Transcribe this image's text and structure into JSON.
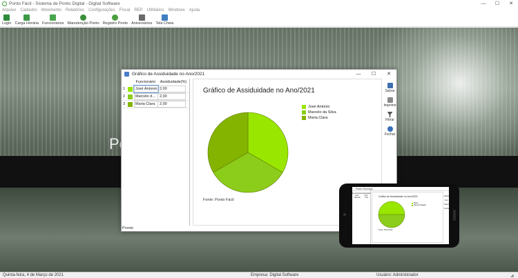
{
  "app": {
    "title": "Ponto Fácil - Sistema de Ponto Digital - Digital Software"
  },
  "window_controls": [
    "—",
    "☐",
    "✕"
  ],
  "menu": [
    "Arquivo",
    "Cadastro",
    "Movimento",
    "Relatórios",
    "Configurações",
    "Fiscal",
    "REP",
    "Utilitários",
    "Windows",
    "Ajuda"
  ],
  "toolbar": [
    {
      "label": "Login",
      "icon": "login-icon",
      "color": "#2e8b3a"
    },
    {
      "label": "Carga Horária",
      "icon": "schedule-icon",
      "color": "#3c9a46"
    },
    {
      "label": "Funcionários",
      "icon": "employees-icon",
      "color": "#4aa54f"
    },
    {
      "label": "Manutenção Ponto",
      "icon": "maintenance-icon",
      "color": "#3a8f3a"
    },
    {
      "label": "Registro Ponto",
      "icon": "clock-register-icon",
      "color": "#4b9f3f"
    },
    {
      "label": "Aniversários",
      "icon": "birthday-icon",
      "color": "#6a6a6a"
    },
    {
      "label": "Tela Cheia",
      "icon": "fullscreen-icon",
      "color": "#3f7fbf"
    }
  ],
  "desktop": {
    "banner_text": "Po"
  },
  "chart_window": {
    "title": "Gráfico de Assiduidade no Ano/2021",
    "grid_headers": {
      "name": "Funcionário",
      "value": "Assiduidade(%)"
    },
    "rows": [
      {
        "num": "1",
        "name": "José Antonio",
        "value": "2,00",
        "color": "#99e600"
      },
      {
        "num": "2",
        "name": "Marcelo da Silva",
        "value": "2,00",
        "color": "#8ccc1a"
      },
      {
        "num": "3",
        "name": "Maria Clara",
        "value": "2,00",
        "color": "#84b300"
      }
    ],
    "sidebar": [
      {
        "label": "Salvar",
        "icon": "save-icon"
      },
      {
        "label": "Imprimir",
        "icon": "printer-icon"
      },
      {
        "label": "Filtrar",
        "icon": "filter-icon"
      },
      {
        "label": "Fechar",
        "icon": "close-icon"
      }
    ],
    "source": "Fonte: Ponto Fácil",
    "status": "Pronto"
  },
  "chart_data": {
    "type": "pie",
    "title": "Gráfico de Assiduidade no Ano/2021",
    "categories": [
      "José Antonio",
      "Marcelo da Silva",
      "Maria Clara"
    ],
    "values": [
      2.0,
      2.0,
      2.0
    ],
    "colors": [
      "#99e600",
      "#8ccc1a",
      "#84b300"
    ],
    "legend": "right"
  },
  "phone": {
    "app_title": "Ponto Fácil App",
    "chart_title": "Gráfico de Assiduidade no Ano/2022",
    "source": "Fonte: Ponto Fácil",
    "grid_headers": [
      "Funcionário",
      "Assiduidade"
    ],
    "rows": [
      {
        "name": "José",
        "value": "2,00"
      },
      {
        "name": "Marcelo",
        "value": "2,00"
      }
    ],
    "legend": [
      "Maria",
      "Marcelo Magaro"
    ],
    "side": [
      "Salvar",
      "Impr.",
      "Filtrar",
      "Fechar"
    ]
  },
  "statusbar": {
    "date": "Quinta-feira, 4 de Março de 2021",
    "company": "Empresa: Digital Software",
    "user": "Usuário: Administrador"
  }
}
